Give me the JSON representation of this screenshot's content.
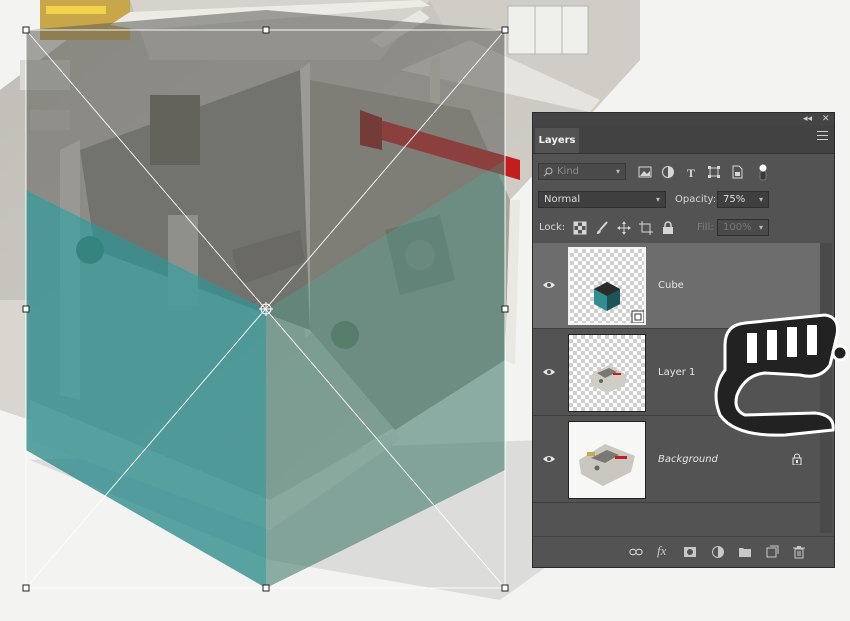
{
  "colors": {
    "panel_bg": "#535353",
    "selected_layer": "#6d6d6d",
    "cube_overlay": "#2c8a8c",
    "floor_plan_wall": "#e9e7e1"
  },
  "panel": {
    "collapse_glyph": "◂◂",
    "close_glyph": "✕",
    "tab_label": "Layers",
    "filter": {
      "kind_placeholder": "Kind",
      "icons": [
        "image-filter-icon",
        "adjustment-filter-icon",
        "type-filter-icon",
        "shape-filter-icon",
        "smart-object-filter-icon"
      ]
    },
    "blend_mode": "Normal",
    "opacity_label": "Opacity:",
    "opacity_value": "75%",
    "lock_label": "Lock:",
    "fill_label": "Fill:",
    "fill_value": "100%",
    "layers": [
      {
        "name": "Cube",
        "selected": true,
        "visible": true,
        "italic": false,
        "locked": false
      },
      {
        "name": "Layer 1",
        "selected": false,
        "visible": true,
        "italic": false,
        "locked": false
      },
      {
        "name": "Background",
        "selected": false,
        "visible": true,
        "italic": true,
        "locked": true
      }
    ],
    "bottom_icons": [
      "link-layers-icon",
      "fx-icon",
      "layer-mask-icon",
      "adjustment-layer-icon",
      "group-folder-icon",
      "new-layer-icon",
      "trash-icon"
    ],
    "fx_label": "fx"
  }
}
